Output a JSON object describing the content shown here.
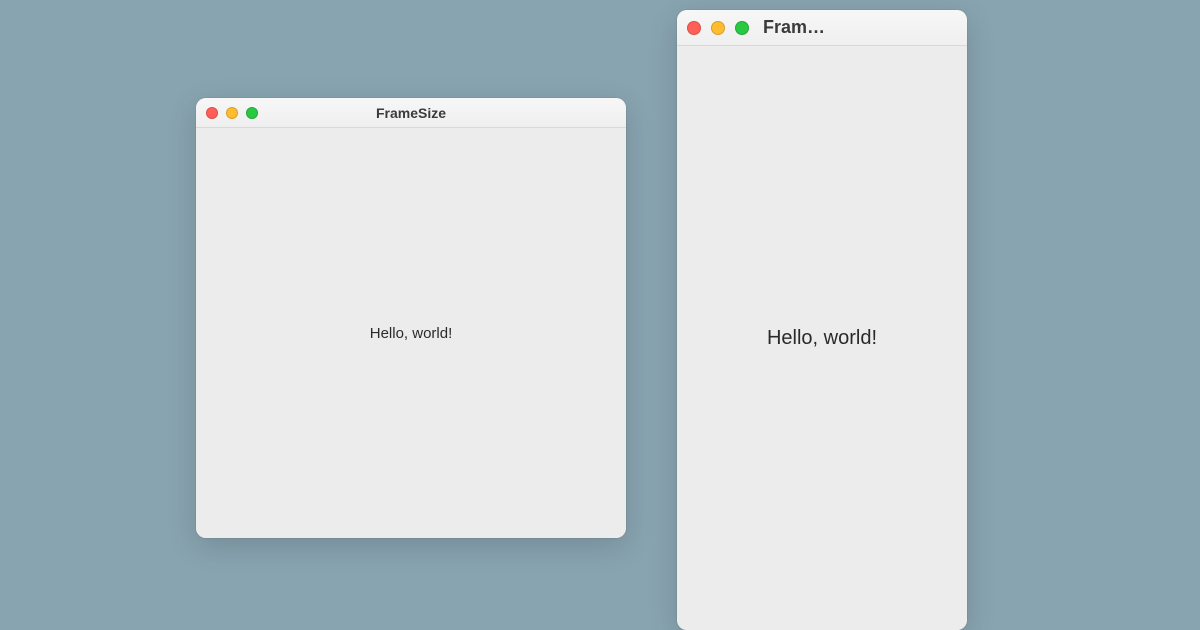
{
  "windows": {
    "left": {
      "title": "FrameSize",
      "content": "Hello, world!"
    },
    "right": {
      "title": "Fram…",
      "content": "Hello, world!"
    }
  }
}
